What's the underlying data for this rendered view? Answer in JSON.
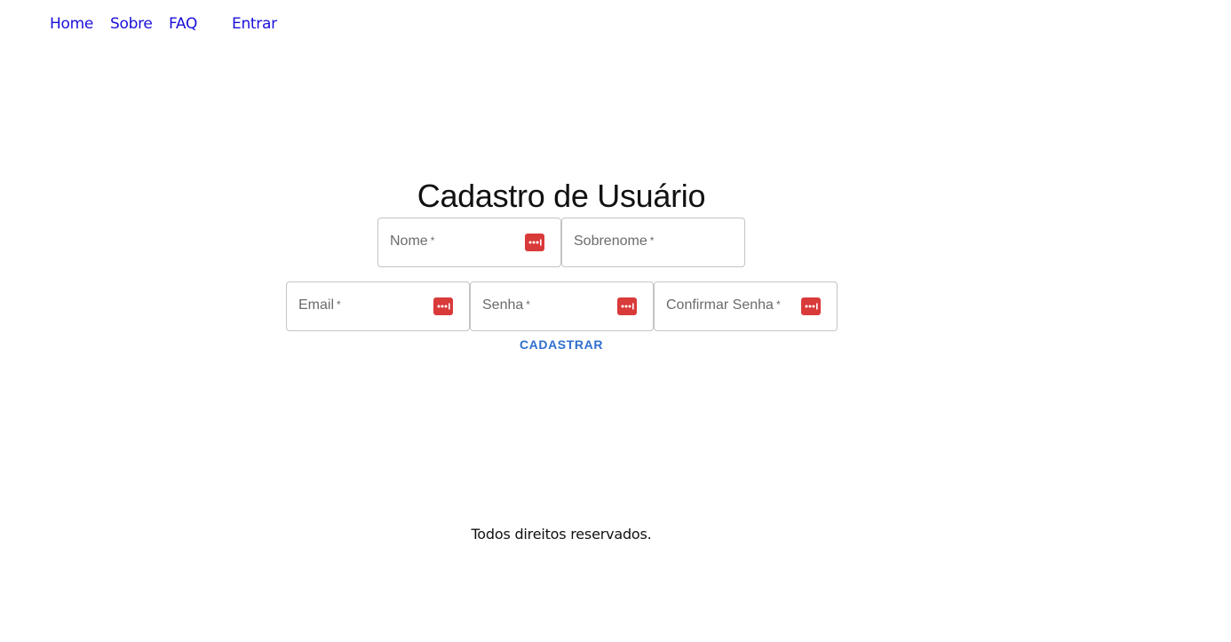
{
  "nav": {
    "items": [
      {
        "label": "Home"
      },
      {
        "label": "Sobre"
      },
      {
        "label": "FAQ"
      },
      {
        "label": "Entrar"
      }
    ]
  },
  "form": {
    "title": "Cadastro de Usuário",
    "fields": {
      "nome": {
        "label": "Nome",
        "required_mark": "*"
      },
      "sobrenome": {
        "label": "Sobrenome",
        "required_mark": "*"
      },
      "email": {
        "label": "Email",
        "required_mark": "*"
      },
      "senha": {
        "label": "Senha",
        "required_mark": "*"
      },
      "confirmar_senha": {
        "label": "Confirmar Senha",
        "required_mark": "*"
      }
    },
    "submit_label": "CADASTRAR"
  },
  "footer": {
    "text": "Todos direitos reservados."
  },
  "colors": {
    "nav_link": "#1a10d8",
    "primary": "#2f6fcf",
    "password_manager_icon": "#d93a3a",
    "field_border": "#c4c4c4"
  },
  "icons": {
    "password_manager": "password-manager-icon"
  }
}
